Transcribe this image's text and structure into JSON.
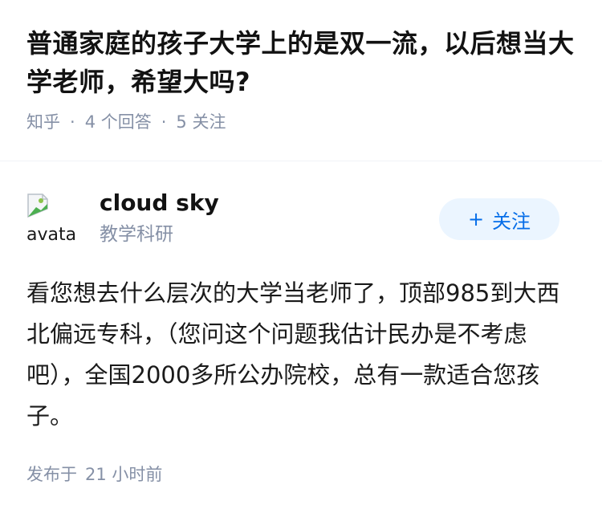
{
  "question": {
    "title": "普通家庭的孩子大学上的是双一流，以后想当大学老师，希望大吗?",
    "source": "知乎",
    "separator": "·",
    "answers_count": "4 个回答",
    "followers_count": "5 关注"
  },
  "answer": {
    "author": {
      "avatar_alt": "avatar",
      "avatar_icon": "broken-image-icon",
      "name": "cloud sky",
      "bio": "教学科研"
    },
    "follow_button": {
      "icon": "plus-icon",
      "plus": "+",
      "label": "关注"
    },
    "body": "看您想去什么层次的大学当老师了，顶部985到大西北偏远专科，（您问这个问题我估计民办是不考虑吧），全国2000多所公办院校，总有一款适合您孩子。",
    "footer": {
      "label": "发布于",
      "time": "21 小时前"
    }
  },
  "colors": {
    "meta_gray": "#8590a6",
    "follow_bg": "#ebf5ff",
    "follow_text": "#056de8",
    "title": "#121212"
  }
}
